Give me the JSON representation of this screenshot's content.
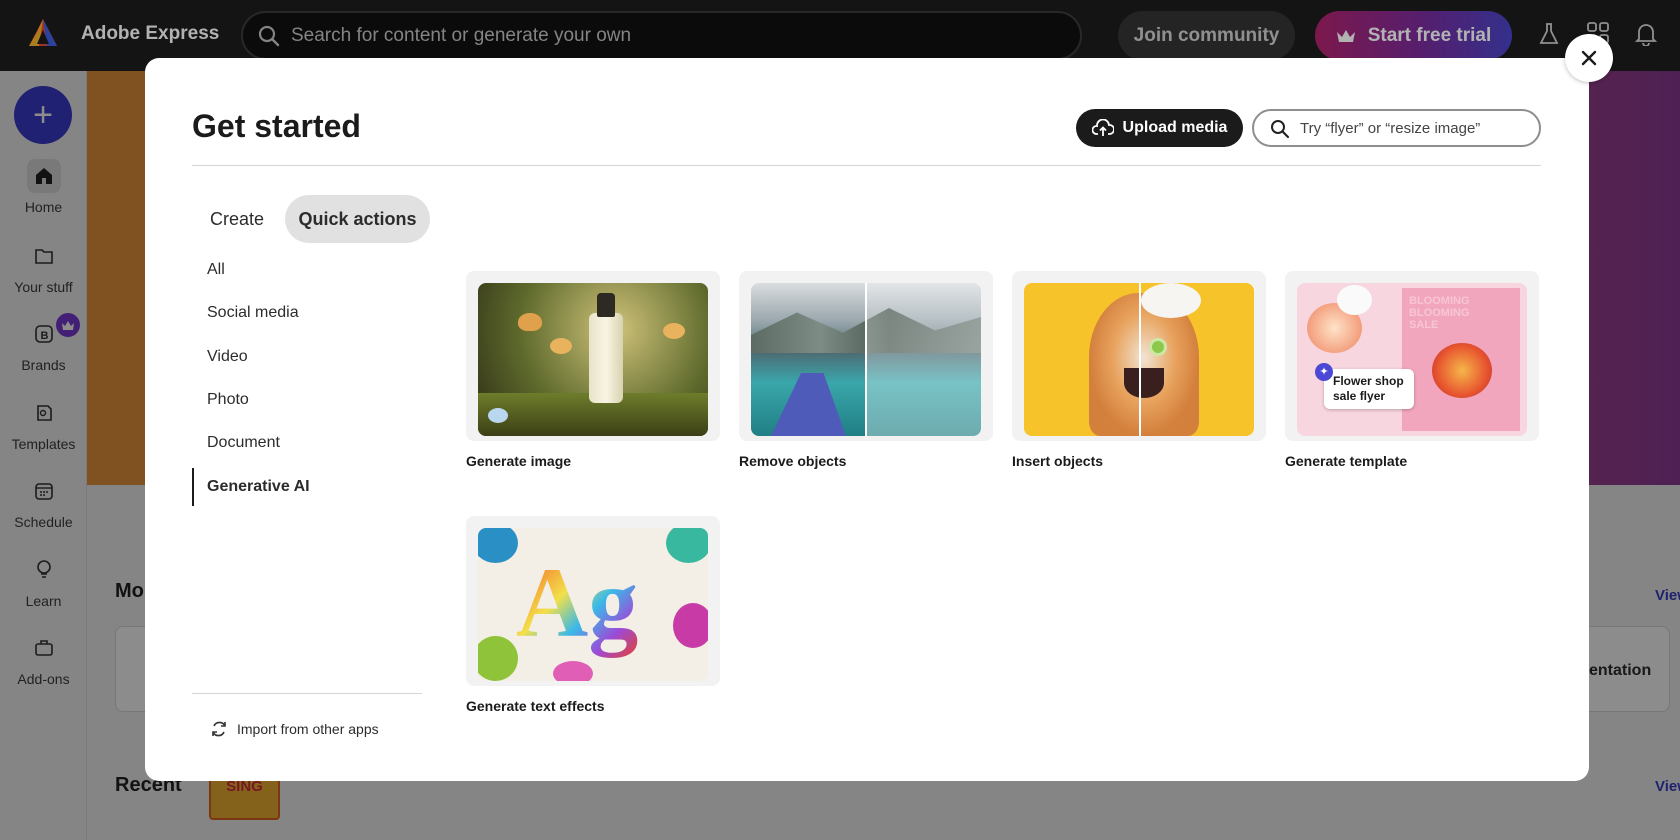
{
  "app": {
    "title": "Adobe Express"
  },
  "topbar": {
    "search_placeholder": "Search for content or generate your own",
    "join_label": "Join community",
    "trial_label": "Start free trial",
    "icons": [
      "flask-icon",
      "apps-grid-icon",
      "bell-icon"
    ]
  },
  "rail": {
    "create_icon": "plus-icon",
    "items": [
      {
        "label": "Home",
        "icon": "home-icon"
      },
      {
        "label": "Your stuff",
        "icon": "folder-icon"
      },
      {
        "label": "Brands",
        "icon": "brand-icon"
      },
      {
        "label": "Templates",
        "icon": "templates-icon"
      },
      {
        "label": "Schedule",
        "icon": "calendar-icon"
      },
      {
        "label": "Learn",
        "icon": "lightbulb-icon"
      },
      {
        "label": "Add-ons",
        "icon": "addons-icon"
      }
    ]
  },
  "background": {
    "section_partial": "Mo",
    "view_link": "View",
    "card_partial": "entation",
    "recent_label": "Recent",
    "recent_thumb_text": "SING",
    "view_link_2": "View"
  },
  "modal": {
    "title": "Get started",
    "upload_label": "Upload media",
    "search_placeholder": "Try “flyer” or “resize image”",
    "tabs": [
      {
        "label": "Create",
        "active": false
      },
      {
        "label": "Quick actions",
        "active": true
      }
    ],
    "categories": [
      {
        "label": "All"
      },
      {
        "label": "Social media"
      },
      {
        "label": "Video"
      },
      {
        "label": "Photo"
      },
      {
        "label": "Document"
      },
      {
        "label": "Generative AI",
        "active": true
      }
    ],
    "import_label": "Import from other apps",
    "cards": [
      {
        "label": "Generate image"
      },
      {
        "label": "Remove objects"
      },
      {
        "label": "Insert objects"
      },
      {
        "label": "Generate template",
        "overlay_text_1": "Flower shop",
        "overlay_text_2": "sale flyer",
        "poster_text_1": "BLOOMING",
        "poster_text_2": "BLOOMING",
        "poster_text_3": "SALE"
      },
      {
        "label": "Generate text effects",
        "thumb_text": "Ag"
      }
    ]
  },
  "colors": {
    "accent": "#3b3ccf",
    "topbar": "#1e1e1e",
    "brand_badge": "#7a3bd6"
  }
}
